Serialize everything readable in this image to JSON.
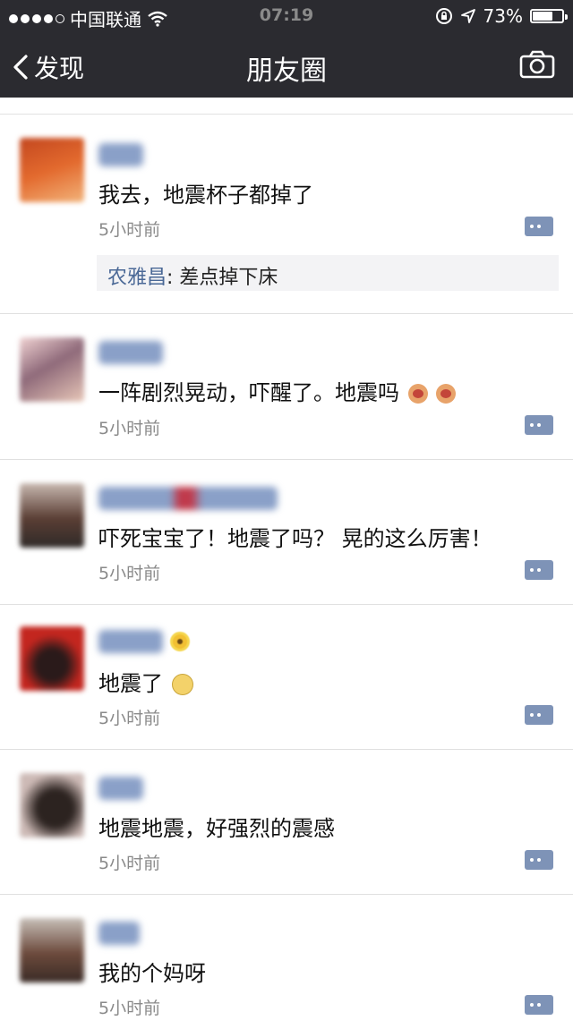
{
  "status_bar": {
    "carrier": "中国联通",
    "time": "07:19",
    "battery": "73%",
    "battery_level": 0.73,
    "signal_dots": [
      1,
      1,
      1,
      1,
      0
    ]
  },
  "nav": {
    "back_label": "发现",
    "title": "朋友圈",
    "camera_icon": "camera-icon"
  },
  "colors": {
    "bar_bg": "#2b2b30",
    "link_blue": "#4a6896",
    "comment_btn": "#7e93b7"
  },
  "posts": [
    {
      "text": "我去，地震杯子都掉了",
      "time": "5小时前",
      "comment": {
        "author": "农雅昌",
        "sep": ": ",
        "text": "差点掉下床"
      }
    },
    {
      "text": "一阵剧烈晃动，吓醒了。地震吗",
      "time": "5小时前",
      "emojis": [
        "angry-face",
        "angry-face"
      ]
    },
    {
      "text": "吓死宝宝了！地震了吗？ 晃的这么厉害！",
      "time": "5小时前"
    },
    {
      "text": "地震了",
      "time": "5小时前",
      "emojis": [
        "sad-face"
      ]
    },
    {
      "text": "地震地震，好强烈的震感",
      "time": "5小时前"
    },
    {
      "text": "我的个妈呀",
      "time": "5小时前"
    }
  ]
}
